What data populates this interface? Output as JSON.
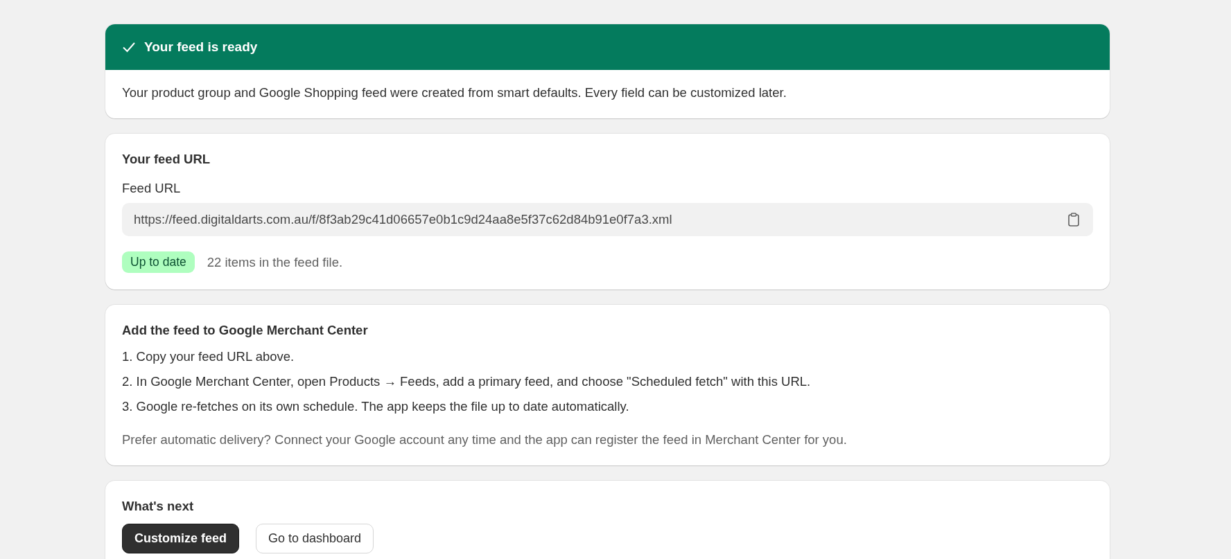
{
  "banner": {
    "title": "Your feed is ready",
    "message": "Your product group and Google Shopping feed were created from smart defaults. Every field can be customized later."
  },
  "feed_url_card": {
    "title": "Your feed URL",
    "field_label": "Feed URL",
    "value": "https://feed.digitaldarts.com.au/f/8f3ab29c41d06657e0b1c9d24aa8e5f37c62d84b91e0f7a3.xml",
    "status": {
      "label": "Up to date",
      "kind": "success"
    },
    "item_count": "22 items in the feed file."
  },
  "merchant_card": {
    "title": "Add the feed to Google Merchant Center",
    "steps": [
      {
        "number": "1.",
        "text": "Copy your feed URL above."
      },
      {
        "number": "2.",
        "text": "In Google Merchant Center, open Products → Feeds, add a primary feed, and choose \"Scheduled fetch\" with this URL."
      },
      {
        "number": "3.",
        "text": "Google re-fetches on its own schedule. The app keeps the file up to date automatically."
      }
    ],
    "note": "Prefer automatic delivery? Connect your Google account any time and the app can register the feed in Merchant Center for you."
  },
  "next_card": {
    "title": "What's next",
    "buttons": [
      {
        "label": "Customize feed",
        "kind": "primary"
      },
      {
        "label": "Go to dashboard",
        "kind": "secondary"
      }
    ]
  }
}
